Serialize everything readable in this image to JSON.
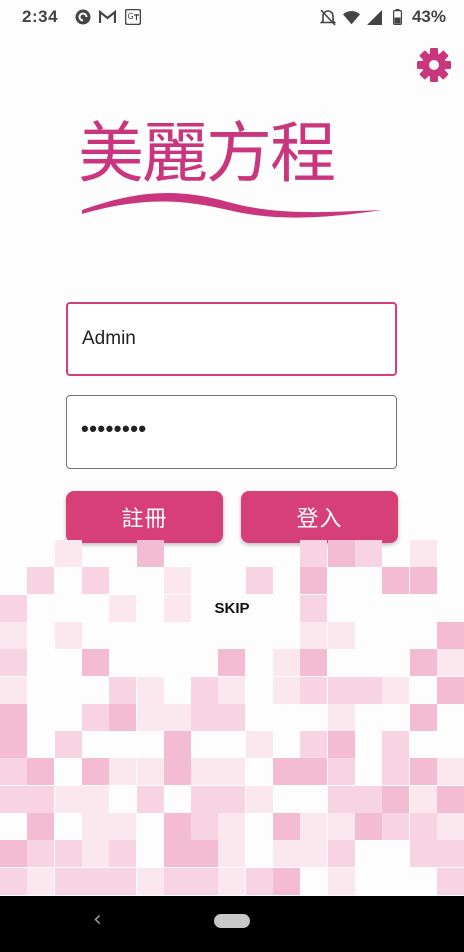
{
  "status_bar": {
    "time": "2:34",
    "icons": [
      "pocket-casts-icon",
      "gmail-icon",
      "translate-icon"
    ],
    "right_icons": [
      "do-not-disturb-icon",
      "wifi-icon",
      "signal-icon",
      "battery-icon"
    ],
    "battery": "43%"
  },
  "settings_icon": "gear-icon",
  "logo": {
    "text": "美麗方程",
    "color": "#c9367e"
  },
  "login": {
    "username_value": "Admin",
    "password_value": "••••••••",
    "register_label": "註冊",
    "login_label": "登入",
    "skip_label": "SKIP"
  },
  "colors": {
    "accent": "#d73f79",
    "focus_border": "#d23e7c",
    "mosaic_pink": [
      "#fbe8ef",
      "#f8d3e1",
      "#f4bcd3"
    ]
  },
  "nav": {
    "back_icon": "back-chevron-icon",
    "home_icon": "home-pill-icon"
  }
}
